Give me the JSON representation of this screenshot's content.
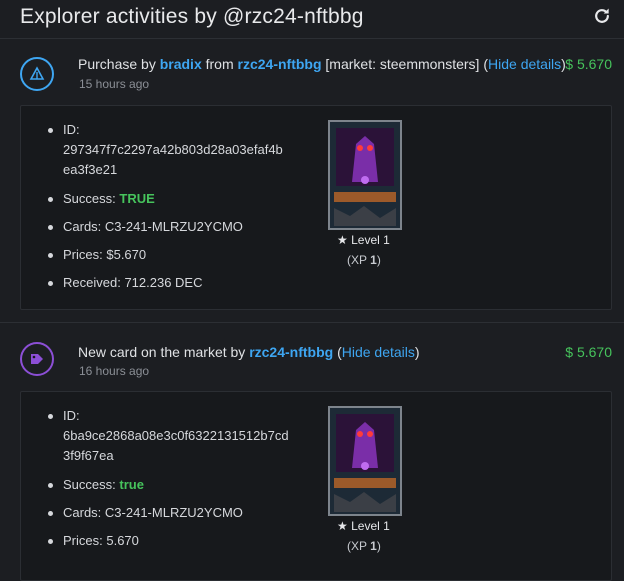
{
  "header": {
    "title": "Explorer activities by @rzc24-nftbbg",
    "refresh_icon": "refresh-icon"
  },
  "activities": [
    {
      "icon": "market-tent-icon",
      "icon_color": "#3ea6f2",
      "type_label": "Purchase by",
      "buyer": "bradix",
      "from_word": "from",
      "seller": "rzc24-nftbbg",
      "market_text": "[market: steemmonsters]",
      "paren_open": "(",
      "hide_details": "Hide details",
      "paren_close": ")",
      "time": "15 hours ago",
      "amount": "$ 5.670",
      "details": {
        "id_label": "ID:",
        "id_line1": "297347f7c2297a42b803d28a03efaf4b",
        "id_line2": "ea3f3e21",
        "success_label": "Success:",
        "success_value": "TRUE",
        "cards_label": "Cards:",
        "cards_value": "C3-241-MLRZU2YCMO",
        "prices_label": "Prices:",
        "prices_value": "$5.670",
        "received_label": "Received:",
        "received_value": "712.236 DEC"
      },
      "card": {
        "level": "Level 1",
        "xp_prefix": "(XP ",
        "xp_value": "1",
        "xp_suffix": ")"
      }
    },
    {
      "icon": "tag-icon",
      "icon_color": "#8c4fd6",
      "type_label": "New card on the market by",
      "seller": "rzc24-nftbbg",
      "paren_open": "(",
      "hide_details": "Hide details",
      "paren_close": ")",
      "time": "16 hours ago",
      "amount": "$ 5.670",
      "details": {
        "id_label": "ID:",
        "id_line1": "6ba9ce2868a08e3c0f6322131512b7cd",
        "id_line2": "3f9f67ea",
        "success_label": "Success:",
        "success_value": "true",
        "cards_label": "Cards:",
        "cards_value": "C3-241-MLRZU2YCMO",
        "prices_label": "Prices:",
        "prices_value": "5.670"
      },
      "card": {
        "level": "Level 1",
        "xp_prefix": "(XP ",
        "xp_value": "1",
        "xp_suffix": ")"
      }
    }
  ]
}
